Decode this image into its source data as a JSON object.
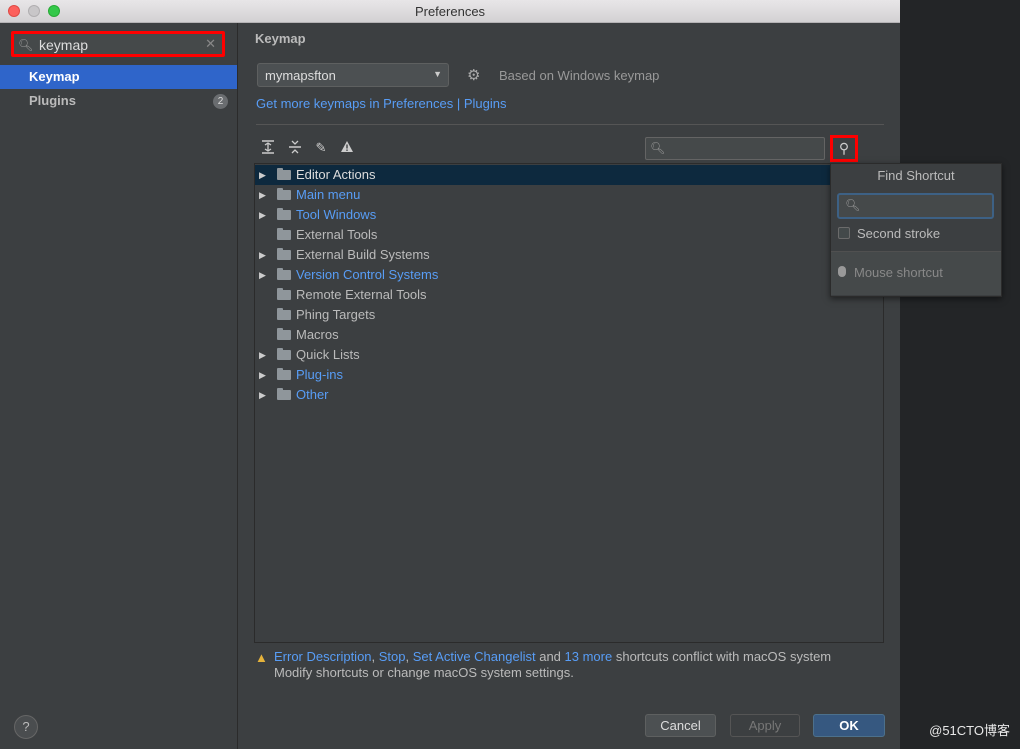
{
  "window": {
    "title": "Preferences"
  },
  "sidebar": {
    "search_value": "keymap",
    "items": [
      {
        "label": "Keymap"
      },
      {
        "label": "Plugins",
        "badge": "2"
      }
    ],
    "help_label": "?"
  },
  "keymap": {
    "section_title": "Keymap",
    "selected_keymap": "mymapsfton",
    "based_on": "Based on Windows keymap",
    "get_more_link": "Get more keymaps in Preferences | Plugins",
    "tree": [
      {
        "label": "Editor Actions"
      },
      {
        "label": "Main menu"
      },
      {
        "label": "Tool Windows"
      },
      {
        "label": "External Tools"
      },
      {
        "label": "External Build Systems"
      },
      {
        "label": "Version Control Systems"
      },
      {
        "label": "Remote External Tools"
      },
      {
        "label": "Phing Targets"
      },
      {
        "label": "Macros"
      },
      {
        "label": "Quick Lists"
      },
      {
        "label": "Plug-ins"
      },
      {
        "label": "Other"
      }
    ]
  },
  "find_shortcut_popup": {
    "title": "Find Shortcut",
    "second_stroke_label": "Second stroke",
    "mouse_shortcut_label": "Mouse shortcut"
  },
  "warning": {
    "links": [
      "Error Description",
      "Stop",
      "Set Active Changelist",
      "13 more"
    ],
    "sep1": ", ",
    "sep2": ", ",
    "sep3": " and ",
    "text_after": " shortcuts conflict with macOS system",
    "line2": "Modify shortcuts or change macOS system settings."
  },
  "buttons": {
    "cancel": "Cancel",
    "apply": "Apply",
    "ok": "OK"
  },
  "watermark": "@51CTO博客"
}
